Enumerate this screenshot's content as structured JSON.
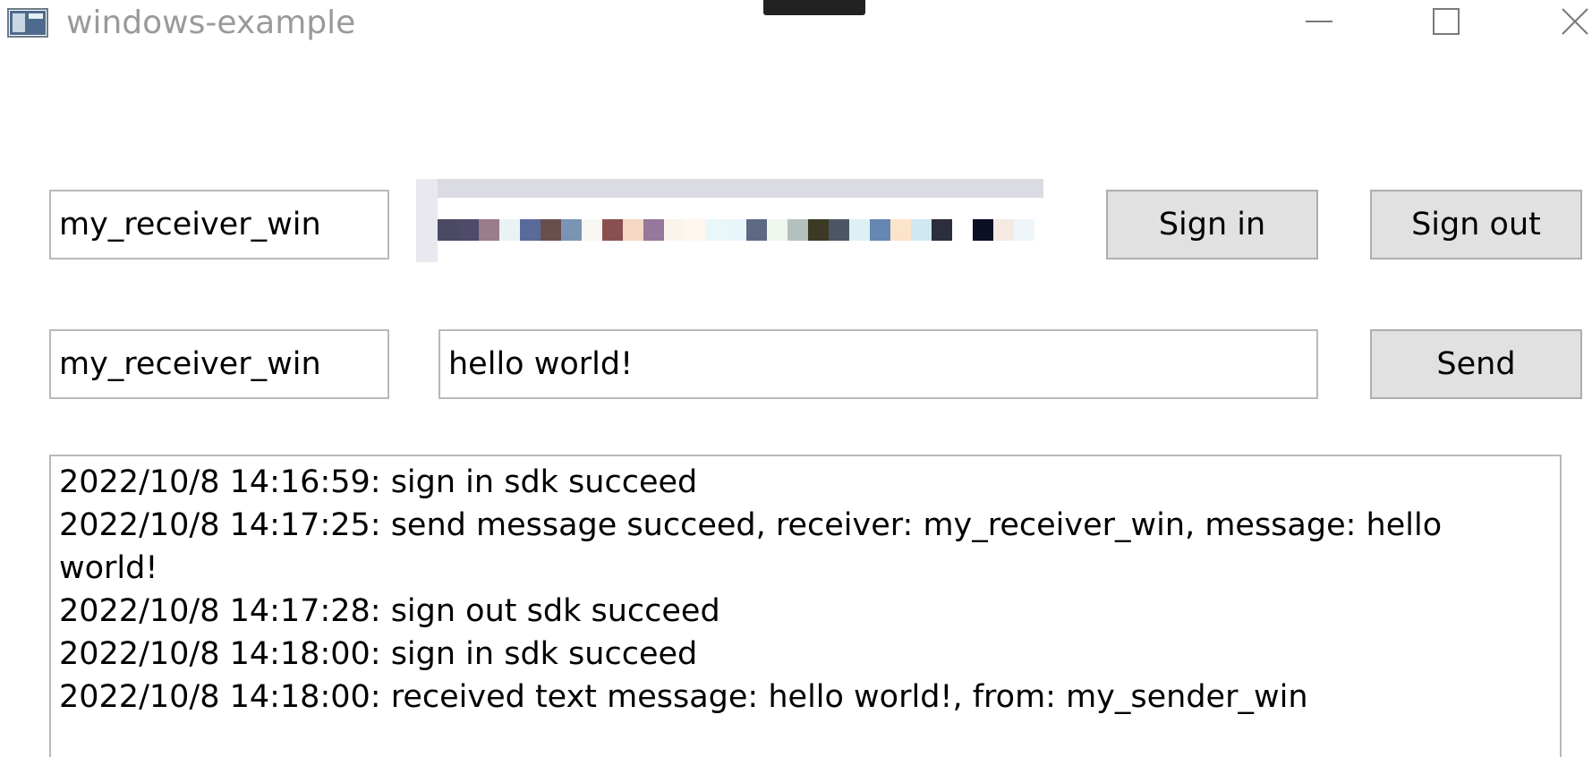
{
  "window": {
    "title": "windows-example",
    "icons": {
      "app": "app-window-icon",
      "minimize": "minimize-icon",
      "maximize": "maximize-icon",
      "close": "close-icon"
    }
  },
  "signin": {
    "user_value": "my_receiver_win",
    "buttons": {
      "sign_in": "Sign in",
      "sign_out": "Sign out"
    }
  },
  "message": {
    "receiver_value": "my_receiver_win",
    "text_value": "hello world!",
    "send_label": "Send"
  },
  "log": {
    "lines": [
      "2022/10/8 14:16:59: sign in sdk succeed",
      "2022/10/8 14:17:25: send message succeed, receiver: my_receiver_win,  message: hello",
      "world!",
      "2022/10/8 14:17:28: sign out sdk succeed",
      "2022/10/8 14:18:00: sign in sdk succeed",
      "2022/10/8 14:18:00: received text message: hello world!, from: my_sender_win"
    ]
  },
  "colors": {
    "button_bg": "#e1e1e1",
    "button_border": "#adadad",
    "field_border": "#b9b9b9",
    "title_text": "#9a9a9a"
  }
}
